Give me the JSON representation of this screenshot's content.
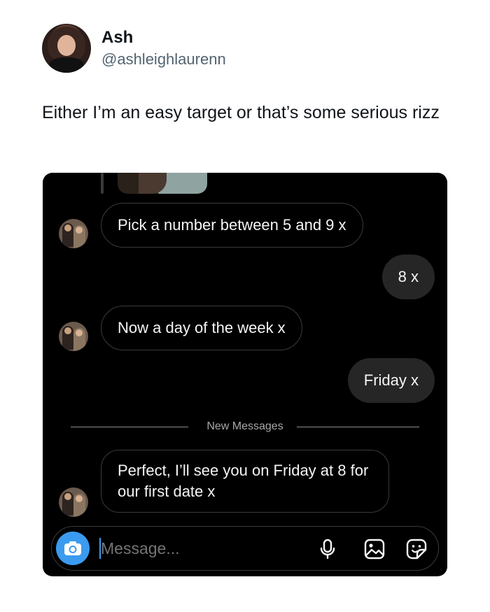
{
  "tweet": {
    "author_name": "Ash",
    "author_handle": "@ashleighlaurenn",
    "text": "Either I’m an easy target or that’s some serious rizz"
  },
  "chat": {
    "messages": [
      {
        "side": "received",
        "text": "Pick a number between 5 and 9 x"
      },
      {
        "side": "sent",
        "text": "8 x"
      },
      {
        "side": "received",
        "text": "Now a day of the week x"
      },
      {
        "side": "sent",
        "text": "Friday x"
      },
      {
        "side": "received",
        "text": "Perfect, I’ll see you on Friday at 8 for our first date x"
      }
    ],
    "divider_label": "New Messages",
    "composer": {
      "placeholder": "Message...",
      "icons": [
        "camera-icon",
        "microphone-icon",
        "gallery-icon",
        "sticker-icon"
      ]
    }
  },
  "colors": {
    "chat_background": "#000000",
    "sent_bubble": "#262626",
    "received_border": "#3a3a3a",
    "accent_blue": "#3b9bf0"
  }
}
